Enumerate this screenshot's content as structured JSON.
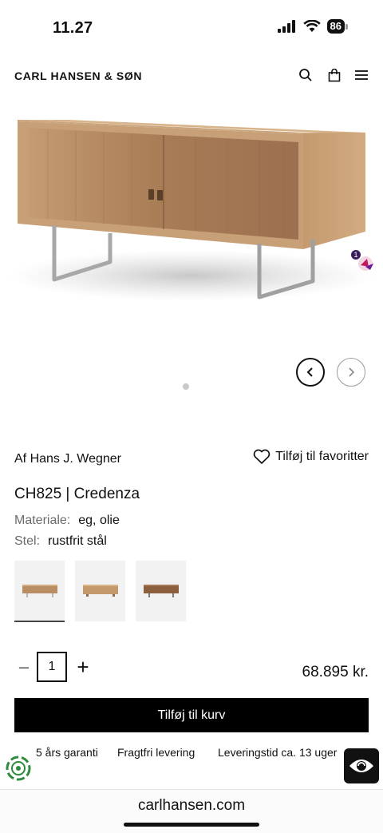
{
  "status_bar": {
    "time": "11.27",
    "battery": "86"
  },
  "header": {
    "brand": "CARL HANSEN & SØN",
    "icons": [
      "search-icon",
      "bag-icon",
      "menu-icon"
    ]
  },
  "hero": {
    "icons": [
      "chevron-left-icon",
      "chevron-right-icon"
    ],
    "badge_count": "1"
  },
  "product": {
    "designer": "Af Hans J. Wegner",
    "favorite_label": "Tilføj til favoritter",
    "title": "CH825 | Credenza",
    "specs": [
      {
        "key": "Materiale:",
        "value": "eg, olie"
      },
      {
        "key": "Stel:",
        "value": "rustfrit stål"
      }
    ],
    "variants_count": 3,
    "selected_variant": 1
  },
  "purchase": {
    "minus": "–",
    "quantity": "1",
    "plus": "+",
    "price": "68.895 kr.",
    "add_to_cart": "Tilføj til kurv"
  },
  "usps": [
    "5 års garanti",
    "Fragtfri levering",
    "Leveringstid ca. 13 uger"
  ],
  "browser": {
    "url": "carlhansen.com"
  },
  "colors": {
    "primary": "#000000",
    "wood": "#b48a61",
    "thumb_bg": "#f2f2f2"
  }
}
